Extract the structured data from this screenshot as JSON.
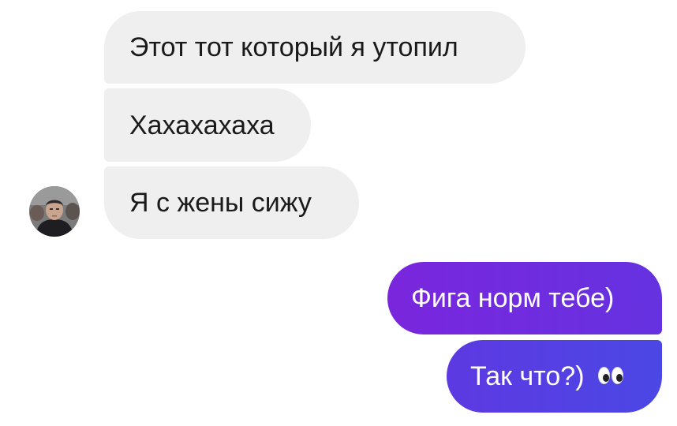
{
  "messages": [
    {
      "id": "msg-1",
      "direction": "incoming",
      "text": "Этот тот который я утопил"
    },
    {
      "id": "msg-2",
      "direction": "incoming",
      "text": "Хахахахаха"
    },
    {
      "id": "msg-3",
      "direction": "incoming",
      "text": "Я с жены сижу"
    },
    {
      "id": "msg-4",
      "direction": "outgoing",
      "text": "Фига норм тебе)"
    },
    {
      "id": "msg-5",
      "direction": "outgoing",
      "text": "Так что?)",
      "emoji": "eyes-emoji"
    }
  ],
  "contact": {
    "avatar_icon": "user-avatar"
  },
  "colors": {
    "incoming_bubble": "#efefef",
    "incoming_text": "#1a1a1a",
    "outgoing_gradient_start": "#7a26dd",
    "outgoing_gradient_end": "#4b47e5",
    "outgoing_text": "#ffffff"
  }
}
